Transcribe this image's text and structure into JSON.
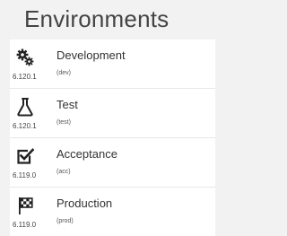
{
  "page_title": "Environments",
  "environments": [
    {
      "name": "Development",
      "code": "(dev)",
      "version": "6.120.1",
      "icon": "gears-icon"
    },
    {
      "name": "Test",
      "code": "(test)",
      "version": "6.120.1",
      "icon": "flask-icon"
    },
    {
      "name": "Acceptance",
      "code": "(acc)",
      "version": "6.119.0",
      "icon": "checkbox-icon"
    },
    {
      "name": "Production",
      "code": "(prod)",
      "version": "6.119.0",
      "icon": "checkered-flag-icon"
    }
  ]
}
